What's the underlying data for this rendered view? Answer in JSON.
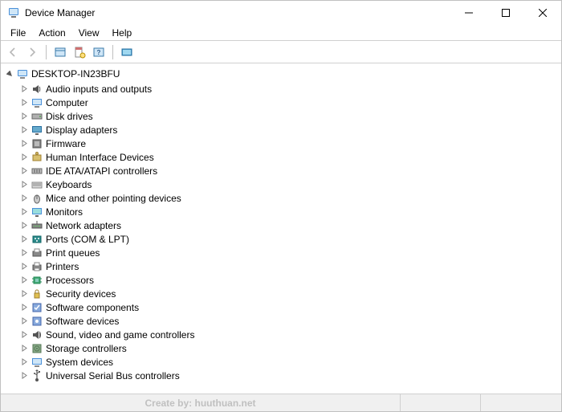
{
  "window": {
    "title": "Device Manager"
  },
  "menu": {
    "items": [
      "File",
      "Action",
      "View",
      "Help"
    ]
  },
  "toolbar": {
    "back": "Back",
    "forward": "Forward",
    "show_hidden": "Show hidden devices",
    "properties": "Properties",
    "help": "Help",
    "views": "Views"
  },
  "tree": {
    "root": "DESKTOP-IN23BFU",
    "categories": [
      {
        "label": "Audio inputs and outputs",
        "icon": "audio"
      },
      {
        "label": "Computer",
        "icon": "computer"
      },
      {
        "label": "Disk drives",
        "icon": "disk"
      },
      {
        "label": "Display adapters",
        "icon": "display"
      },
      {
        "label": "Firmware",
        "icon": "firmware"
      },
      {
        "label": "Human Interface Devices",
        "icon": "hid"
      },
      {
        "label": "IDE ATA/ATAPI controllers",
        "icon": "ide"
      },
      {
        "label": "Keyboards",
        "icon": "keyboard"
      },
      {
        "label": "Mice and other pointing devices",
        "icon": "mouse"
      },
      {
        "label": "Monitors",
        "icon": "monitor"
      },
      {
        "label": "Network adapters",
        "icon": "network"
      },
      {
        "label": "Ports (COM & LPT)",
        "icon": "ports"
      },
      {
        "label": "Print queues",
        "icon": "printqueue"
      },
      {
        "label": "Printers",
        "icon": "printer"
      },
      {
        "label": "Processors",
        "icon": "processor"
      },
      {
        "label": "Security devices",
        "icon": "security"
      },
      {
        "label": "Software components",
        "icon": "swcomp"
      },
      {
        "label": "Software devices",
        "icon": "swdev"
      },
      {
        "label": "Sound, video and game controllers",
        "icon": "sound"
      },
      {
        "label": "Storage controllers",
        "icon": "storage"
      },
      {
        "label": "System devices",
        "icon": "system"
      },
      {
        "label": "Universal Serial Bus controllers",
        "icon": "usb"
      }
    ]
  },
  "status": {
    "watermark": "Create by: huuthuan.net"
  }
}
